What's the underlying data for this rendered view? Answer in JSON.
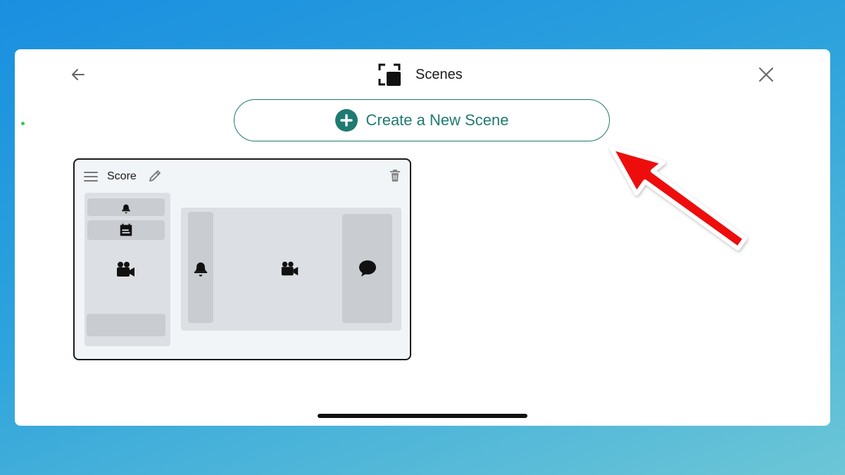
{
  "header": {
    "title": "Scenes",
    "back_icon": "arrow-left-icon",
    "close_icon": "close-icon",
    "title_icon": "scenes-icon"
  },
  "create_button": {
    "label": "Create a New Scene",
    "icon": "plus-circle-icon",
    "accent": "#1f7b72"
  },
  "scenes": [
    {
      "name": "Score",
      "menu_icon": "hamburger-menu-icon",
      "edit_icon": "pencil-icon",
      "delete_icon": "trash-icon",
      "left_panel_icons": [
        "bell-icon",
        "calendar-icon",
        "video-camera-icon"
      ],
      "right_panel_icons": [
        "bell-icon",
        "video-camera-icon",
        "chat-bubble-icon"
      ]
    }
  ],
  "annotation": {
    "arrow_color": "#ee1111"
  }
}
